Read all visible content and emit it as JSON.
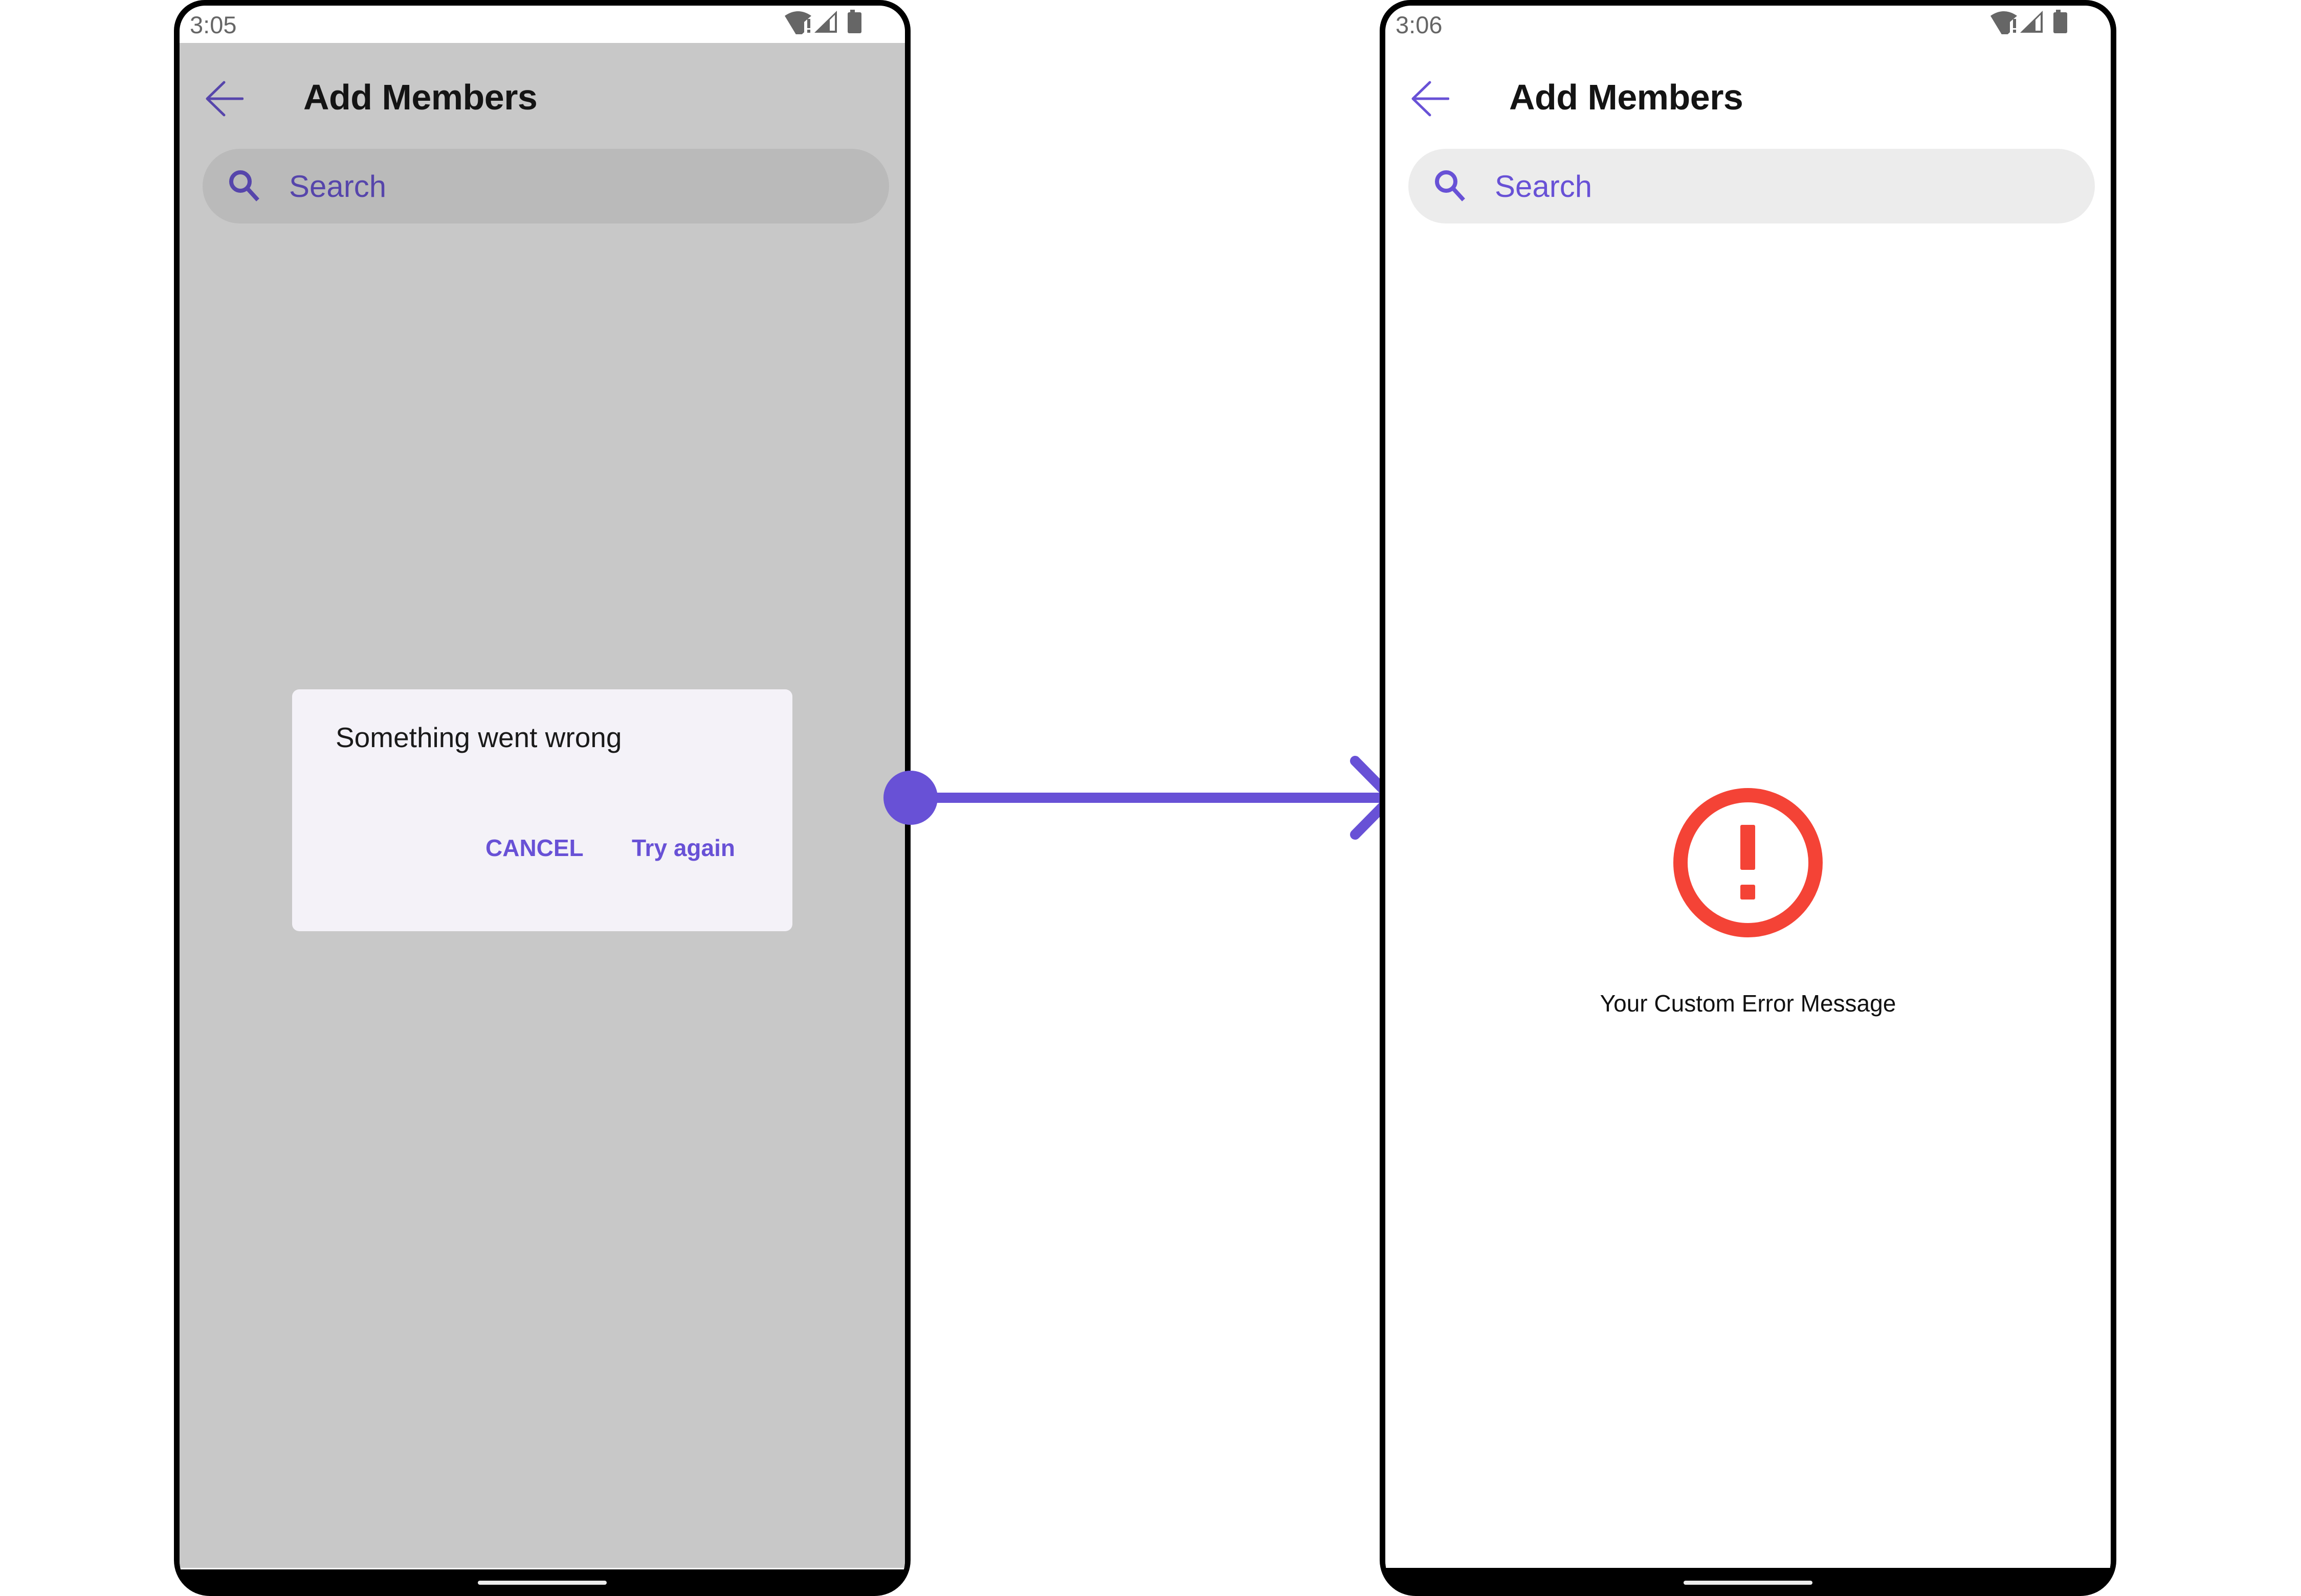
{
  "left_screen": {
    "status_bar": {
      "time": "3:05",
      "icons": [
        "wifi-alert-icon",
        "signal-icon",
        "battery-icon"
      ]
    },
    "header": {
      "back_icon": "arrow-left-icon",
      "title": "Add Members"
    },
    "search": {
      "icon": "search-icon",
      "placeholder": "Search"
    },
    "dialog": {
      "message": "Something went wrong",
      "buttons": {
        "cancel": "CANCEL",
        "retry": "Try again"
      }
    }
  },
  "right_screen": {
    "status_bar": {
      "time": "3:06",
      "icons": [
        "wifi-alert-icon",
        "signal-icon",
        "battery-icon"
      ]
    },
    "header": {
      "back_icon": "arrow-left-icon",
      "title": "Add Members"
    },
    "search": {
      "icon": "search-icon",
      "placeholder": "Search"
    },
    "error_state": {
      "icon": "error-outline-icon",
      "message": "Your Custom Error Message"
    }
  },
  "connector": {
    "type": "flow-arrow",
    "from": "left_screen",
    "to": "right_screen"
  },
  "colors": {
    "accent": "#6851D6",
    "accent_dimmed": "#5645AB",
    "error": "#F44336",
    "scrim": "#C8C8C8",
    "dialog_bg": "#F4F2F8",
    "search_bg_dimmed": "#BABABA",
    "search_bg": "#ECECEC"
  }
}
